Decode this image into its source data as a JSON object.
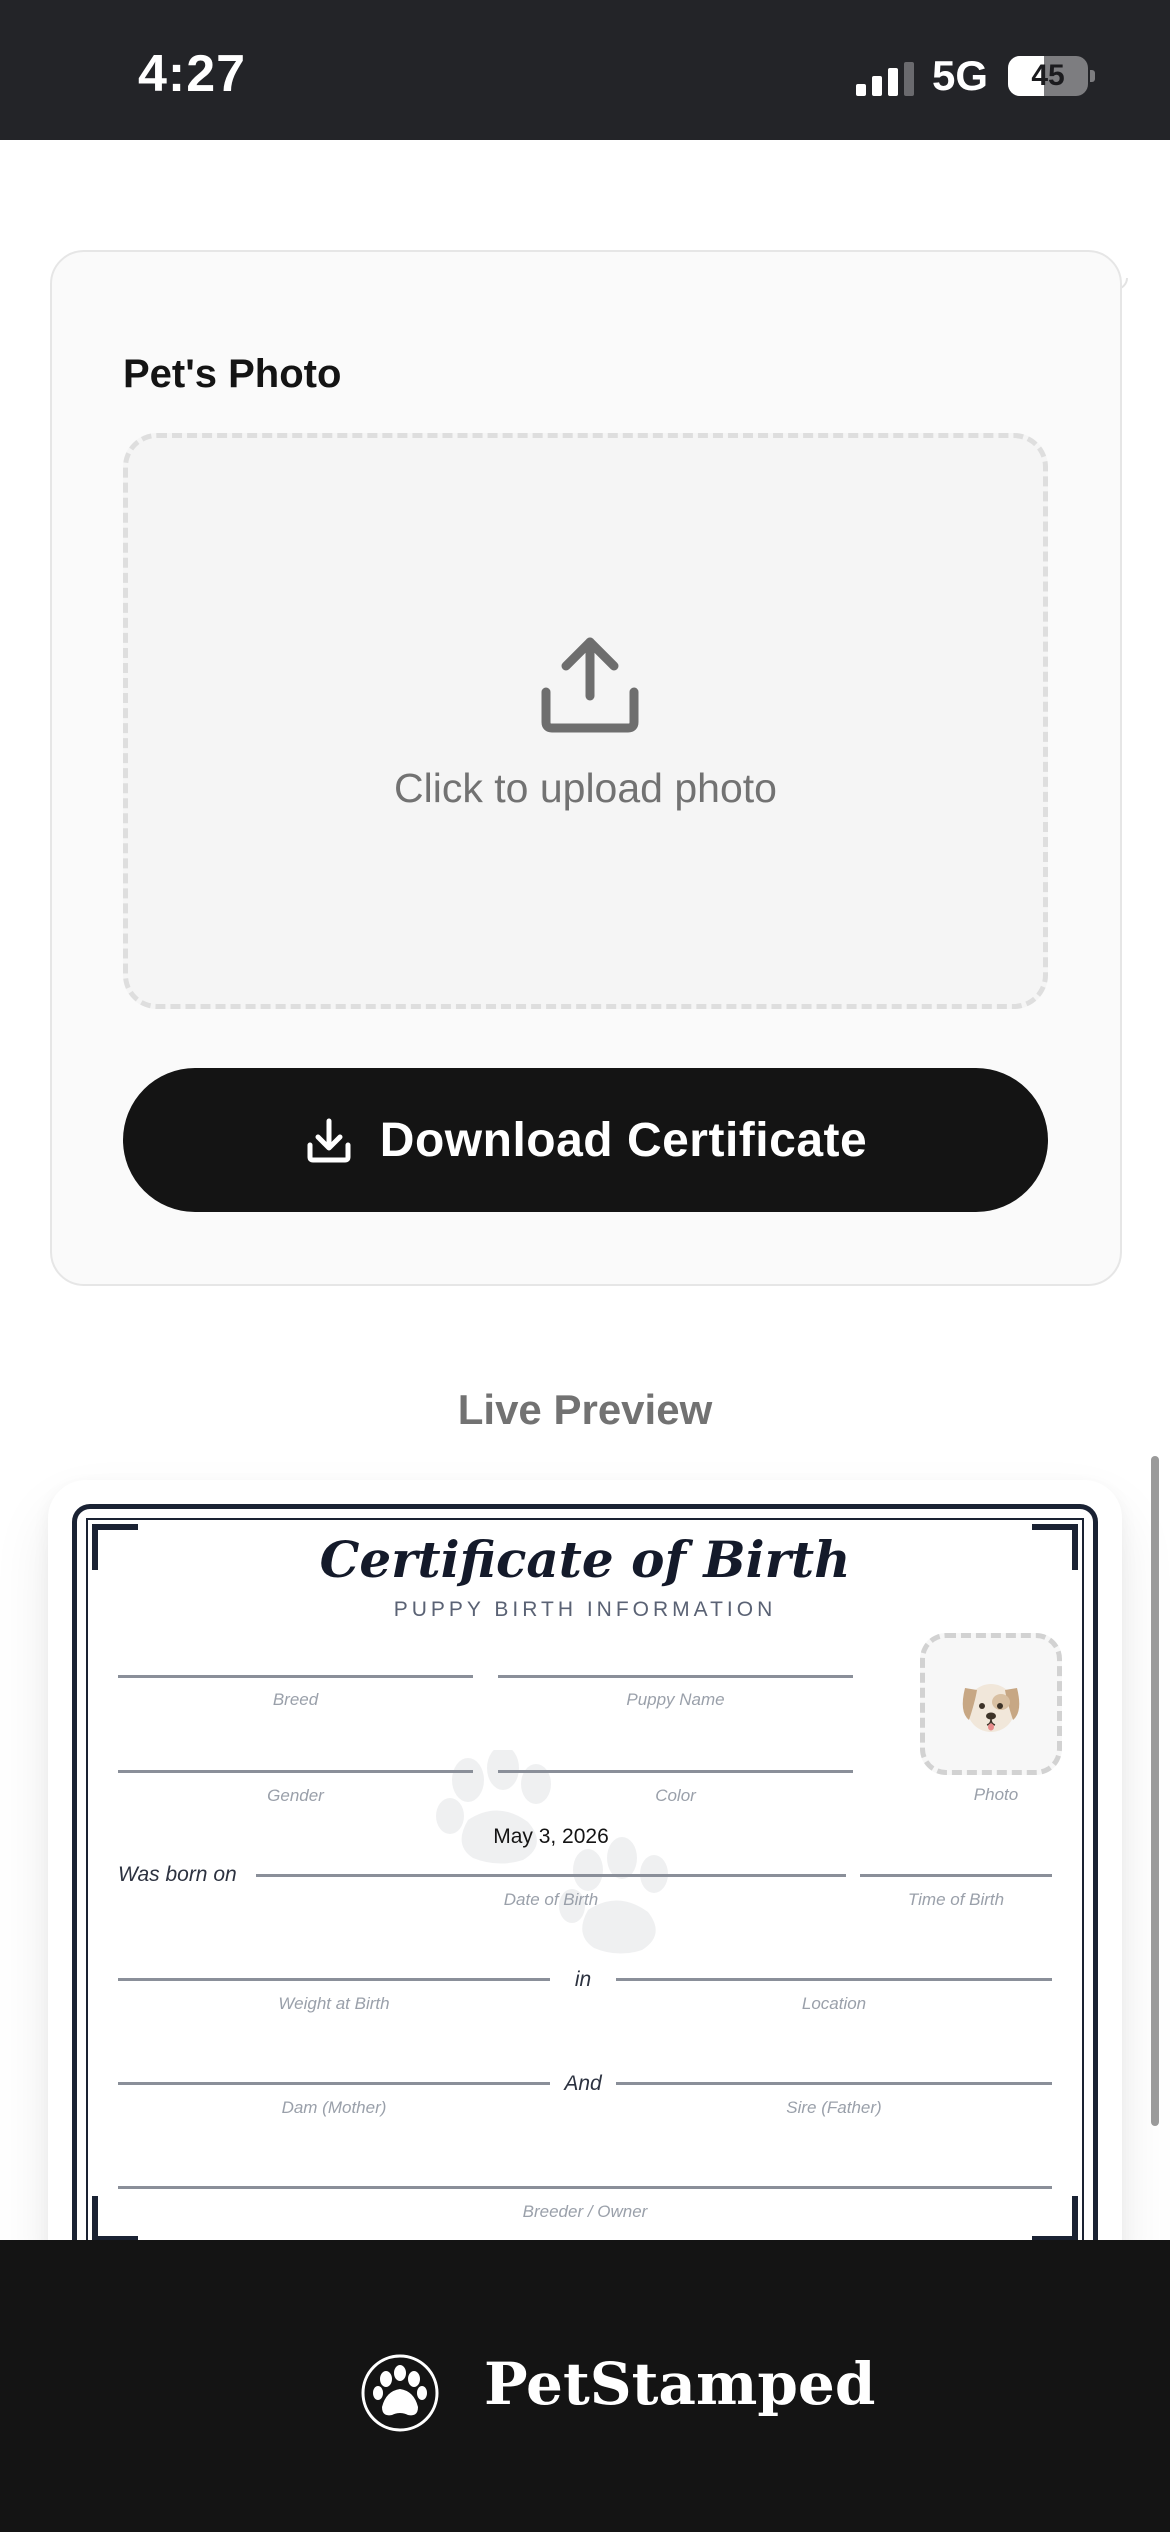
{
  "status_bar": {
    "time": "4:27",
    "network": "5G",
    "battery": "45",
    "battery_level": 0.45
  },
  "form": {
    "photo_label": "Pet's Photo",
    "upload_text": "Click to upload photo",
    "download_label": "Download Certificate"
  },
  "preview": {
    "heading": "Live Preview",
    "certificate": {
      "title": "Certificate of Birth",
      "subtitle": "PUPPY BIRTH INFORMATION",
      "breed": "Breed",
      "puppy_name": "Puppy Name",
      "photo": "Photo",
      "gender": "Gender",
      "color": "Color",
      "born_on": "Was born on",
      "date_value": "May 3, 2026",
      "date_of_birth": "Date of Birth",
      "time_of_birth": "Time of Birth",
      "weight": "Weight at Birth",
      "in_word": "in",
      "location": "Location",
      "dam": "Dam (Mother)",
      "and_word": "And",
      "sire": "Sire (Father)",
      "breeder": "Breeder / Owner"
    }
  },
  "footer": {
    "brand": "PetStamped"
  },
  "colors": {
    "primary": "#141414",
    "navy": "#1a2233",
    "muted": "#727272"
  }
}
